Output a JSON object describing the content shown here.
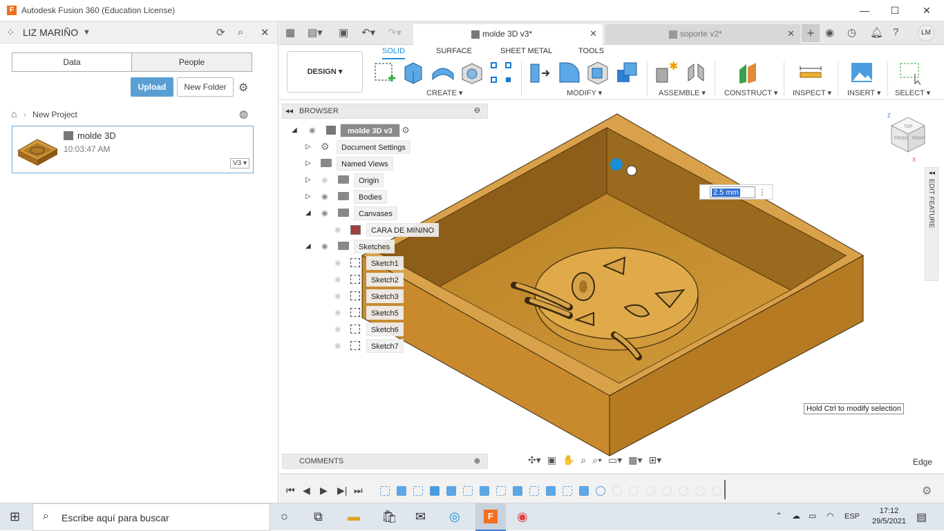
{
  "window": {
    "title": "Autodesk Fusion 360 (Education License)",
    "minimize": "—",
    "maximize": "☐",
    "close": "✕"
  },
  "leftpanel": {
    "user": "LIZ MARIÑO",
    "tabs": [
      "Data",
      "People"
    ],
    "upload": "Upload",
    "new_folder": "New Folder",
    "breadcrumb": "New Project",
    "card": {
      "name": "molde 3D",
      "time": "10:03:47 AM",
      "version": "V3"
    }
  },
  "doc_tabs": [
    {
      "label": "molde 3D v3*",
      "close": "✕"
    },
    {
      "label": "soporte v2*",
      "close": "✕"
    }
  ],
  "ribbon": {
    "workspace": "DESIGN",
    "tabs": [
      "SOLID",
      "SURFACE",
      "SHEET METAL",
      "TOOLS"
    ],
    "groups": [
      "CREATE",
      "MODIFY",
      "ASSEMBLE",
      "CONSTRUCT",
      "INSPECT",
      "INSERT",
      "SELECT"
    ]
  },
  "browser": {
    "title": "BROWSER",
    "root": "molde 3D v3",
    "nodes": [
      "Document Settings",
      "Named Views",
      "Origin",
      "Bodies",
      "Canvases",
      "CARA DE MININO",
      "Sketches",
      "Sketch1",
      "Sketch2",
      "Sketch3",
      "Sketch5",
      "Sketch6",
      "Sketch7"
    ]
  },
  "comments": "COMMENTS",
  "dimension": {
    "value": "2.5 mm"
  },
  "hint": "Hold Ctrl to modify selection",
  "edit_feature": "EDIT FEATURE",
  "selection_filter": "Edge",
  "viewcube": {
    "top": "TOP",
    "front": "FRONT",
    "right": "RIGHT",
    "z": "Z",
    "x": "X"
  },
  "taskbar": {
    "search": "Escribe aquí para buscar",
    "lang": "ESP",
    "time": "17:12",
    "date": "29/5/2021"
  },
  "colors": {
    "accent": "#1a8fd8",
    "model": "#c98a2e",
    "upload": "#5a9fd4"
  }
}
